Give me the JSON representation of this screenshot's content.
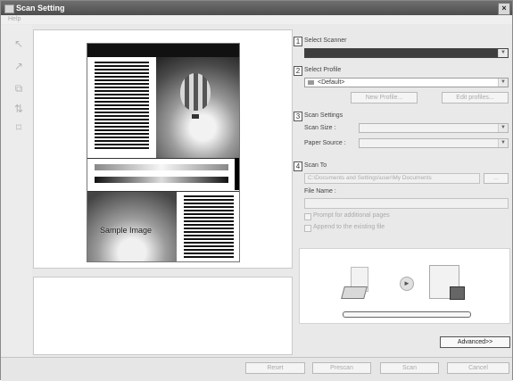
{
  "window": {
    "title": "Scan Setting",
    "close_glyph": "×"
  },
  "menu": {
    "help": "Help"
  },
  "toolbar": {
    "icons": [
      "rotate-left-icon",
      "rotate-right-icon",
      "flip-icon",
      "mirror-icon",
      "crop-icon"
    ],
    "glyphs": [
      "↖",
      "↗",
      "⧉",
      "⇅",
      "⌑"
    ]
  },
  "preview": {
    "sample_text": "Sample Image"
  },
  "sections": {
    "scanner": {
      "num": "1",
      "title": "Select Scanner",
      "value": ""
    },
    "profile": {
      "num": "2",
      "title": "Select Profile",
      "value": "<Default>",
      "new_profile": "New Profile...",
      "edit_profiles": "Edit profiles..."
    },
    "scan": {
      "num": "3",
      "title": "Scan Settings",
      "scan_size_label": "Scan Size :",
      "paper_source_label": "Paper Source :"
    },
    "scan_to": {
      "num": "4",
      "title": "Scan To",
      "path": "C:\\Documents and Settings\\user\\My Documents",
      "browse": "...",
      "file_name_label": "File Name :",
      "file_name_value": "",
      "prompt_label": "Prompt for additional pages",
      "append_label": "Append to the existing file"
    }
  },
  "buttons": {
    "advanced": "Advanced>>",
    "reset": "Reset",
    "prescan": "Prescan",
    "scan": "Scan",
    "cancel": "Cancel"
  }
}
